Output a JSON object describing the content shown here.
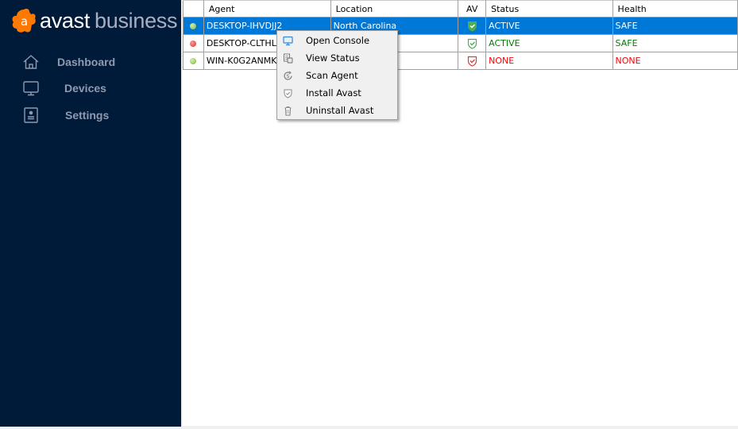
{
  "app": {
    "brand_word1": "avast",
    "brand_word2": "business",
    "brand_color": "#ff7800",
    "sidebar_bg": "#001b3a"
  },
  "sidebar": {
    "items": [
      {
        "label": "Dashboard",
        "icon": "home-icon"
      },
      {
        "label": "Devices",
        "icon": "monitor-icon"
      },
      {
        "label": "Settings",
        "icon": "settings-profile-icon"
      }
    ]
  },
  "table": {
    "columns": [
      "",
      "Agent",
      "Location",
      "AV",
      "Status",
      "Health"
    ],
    "rows": [
      {
        "indicator": "green",
        "agent": "DESKTOP-IHVDJJ2",
        "location": "North Carolina",
        "av": "shield-check-green",
        "status": "ACTIVE",
        "health": "SAFE",
        "selected": true
      },
      {
        "indicator": "red",
        "agent": "DESKTOP-CLTHLSN",
        "location": "",
        "av": "shield-check-green",
        "status": "ACTIVE",
        "health": "SAFE",
        "selected": false
      },
      {
        "indicator": "green",
        "agent": "WIN-K0G2ANMK7U",
        "location": "",
        "av": "shield-check-red",
        "status": "NONE",
        "health": "NONE",
        "selected": false
      }
    ],
    "colors": {
      "selected": "#0078d7",
      "ok": "#008000",
      "bad": "#ff0000",
      "dot_green": "#8bc34a",
      "dot_red": "#e53935"
    }
  },
  "context_menu": {
    "items": [
      {
        "label": "Open Console",
        "icon": "console-icon"
      },
      {
        "label": "View Status",
        "icon": "view-status-icon"
      },
      {
        "label": "Scan Agent",
        "icon": "scan-icon"
      },
      {
        "label": "Install Avast",
        "icon": "shield-icon"
      },
      {
        "label": "Uninstall Avast",
        "icon": "trash-icon"
      }
    ]
  }
}
